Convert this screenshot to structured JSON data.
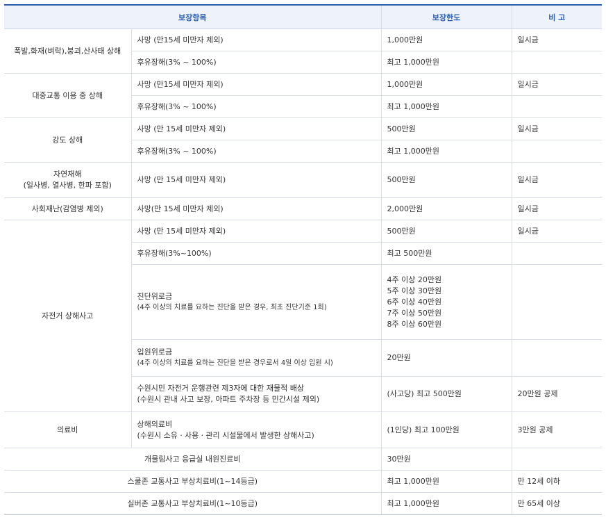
{
  "header": {
    "col1": "보장항목",
    "col2": "보장한도",
    "col3": "비 고"
  },
  "rows": [
    {
      "cat": "폭발,화재(벼락),붕괴,산사태 상해",
      "items": [
        {
          "item": "사망 (만15세 미만자 제외)",
          "limit": "1,000만원",
          "note": "일시금"
        },
        {
          "item": "후유장해(3% ~ 100%)",
          "limit": "최고 1,000만원",
          "note": ""
        }
      ]
    },
    {
      "cat": "대중교통 이용 중 상해",
      "items": [
        {
          "item": "사망 (만15세 미만자 제외)",
          "limit": "1,000만원",
          "note": "일시금"
        },
        {
          "item": "후유장해(3% ~ 100%)",
          "limit": "최고 1,000만원",
          "note": ""
        }
      ]
    },
    {
      "cat": "강도 상해",
      "items": [
        {
          "item": "사망 (만 15세 미만자 제외)",
          "limit": "500만원",
          "note": "일시금"
        },
        {
          "item": "후유장해(3% ~ 100%)",
          "limit": "최고 1,000만원",
          "note": ""
        }
      ]
    },
    {
      "cat_line1": "자연재해",
      "cat_line2": "(일사병, 열사병, 한파 포함)",
      "item": "사망 (만 15세 미만자 제외)",
      "limit": "500만원",
      "note": "일시금"
    },
    {
      "cat": "사회재난(감염병 제외)",
      "item": "사망(만 15세 미만자 제외)",
      "limit": "2,000만원",
      "note": "일시금"
    },
    {
      "cat": "자전거 상해사고",
      "death": {
        "item": "사망 (만 15세 미만자 제외)",
        "limit": "500만원",
        "note": "일시금"
      },
      "disability": {
        "item": "후유장해(3%~100%)",
        "limit": "최고 500만원",
        "note": ""
      },
      "diagnosis": {
        "title": "진단위로금",
        "sub": "(4주 이상의 치료를 요하는 진단을 받은 경우, 최초 진단기준 1회)",
        "limits": [
          "4주 이상 20만원",
          "5주 이상 30만원",
          "6주 이상 40만원",
          "7주 이상 50만원",
          "8주 이상 60만원"
        ],
        "note": ""
      },
      "hospital": {
        "title": "입원위로금",
        "sub": "(4주 이상의 치료를 요하는 진단을 받은 경우로서 4일 이상 입원 시)",
        "limit": "20만원",
        "note": ""
      },
      "liability": {
        "line1": "수원시민 자전거 운행관련 제3자에 대한 재물적 배상",
        "line2": "(수원시 관내 사고 보장, 아파트 주차장 등 민간시설 제외)",
        "limit": "(사고당) 최고 500만원",
        "note": "20만원 공제"
      }
    },
    {
      "cat": "의료비",
      "line1": "상해의료비",
      "line2": "(수원시 소유ㆍ사용ㆍ관리 시설물에서 발생한 상해사고)",
      "limit": "(1인당) 최고 100만원",
      "note": "3만원 공제"
    },
    {
      "cat": "개물림사고 응급실 내원진료비",
      "limit": "30만원",
      "note": ""
    },
    {
      "cat": "스쿨존 교통사고 부상치료비(1~14등급)",
      "limit": "최고 1,000만원",
      "note": "만 12세 이하"
    },
    {
      "cat": "실버존 교통사고 부상치료비(1~10등급)",
      "limit": "최고 1,000만원",
      "note": "만 65세 이상"
    }
  ]
}
